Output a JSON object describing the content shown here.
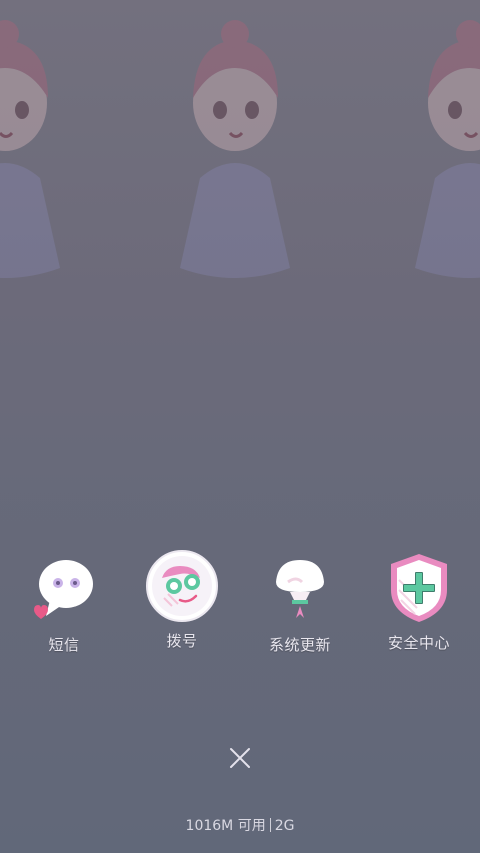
{
  "apps": [
    {
      "label": "短信",
      "icon": "sms-icon"
    },
    {
      "label": "拨号",
      "icon": "dialer-icon"
    },
    {
      "label": "系统更新",
      "icon": "system-update-icon"
    },
    {
      "label": "安全中心",
      "icon": "security-center-icon"
    }
  ],
  "status": {
    "memory_text": "1016M 可用",
    "network_text": "2G"
  },
  "close": {
    "icon": "close-icon"
  },
  "colors": {
    "background": "#777586",
    "label": "#e8e6ee",
    "accent_green": "#5cc8a0",
    "accent_pink": "#e98bc0"
  }
}
